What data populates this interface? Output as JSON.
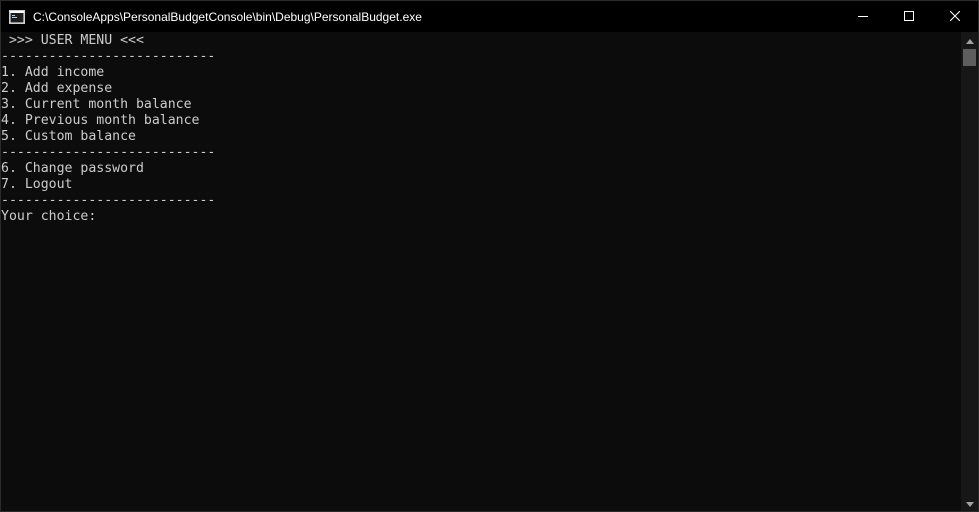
{
  "window": {
    "title": "C:\\ConsoleApps\\PersonalBudgetConsole\\bin\\Debug\\PersonalBudget.exe",
    "icon": "console-window-icon",
    "controls": [
      "minimize-icon",
      "maximize-icon",
      "close-icon"
    ]
  },
  "console": {
    "header": " >>> USER MENU <<<",
    "separator_1": "---------------------------",
    "items": [
      "1. Add income",
      "2. Add expense",
      "3. Current month balance",
      "4. Previous month balance",
      "5. Custom balance"
    ],
    "separator_2": "---------------------------",
    "account_items": [
      "6. Change password",
      "7. Logout"
    ],
    "separator_3": "---------------------------",
    "prompt": "Your choice:"
  },
  "colors": {
    "background": "#0c0c0c",
    "text": "#cccccc",
    "titlebar": "#000000"
  }
}
